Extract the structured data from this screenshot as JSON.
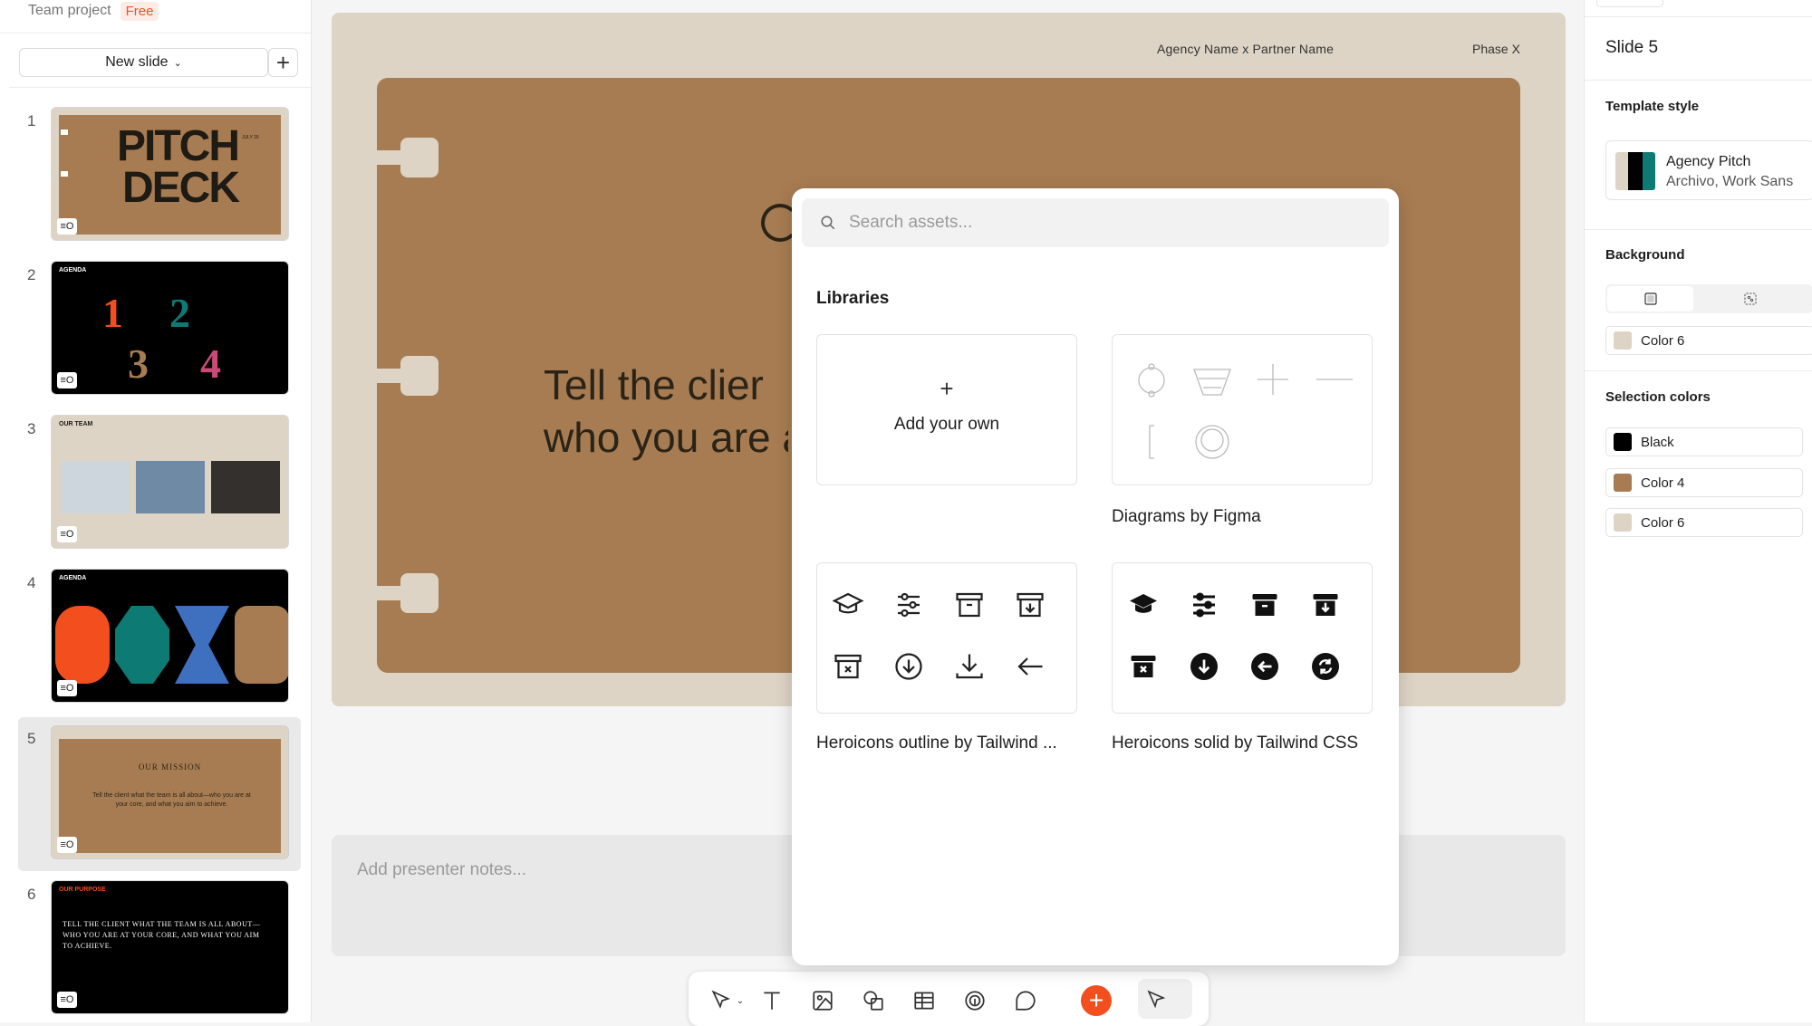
{
  "sidebar": {
    "project": "Team project",
    "badge": "Free",
    "new_slide": "New slide",
    "add_icon": "plus-icon",
    "slides": [
      {
        "num": "1",
        "title": "PITCH DECK",
        "sub": "JULY 26"
      },
      {
        "num": "2",
        "title": "AGENDA"
      },
      {
        "num": "3",
        "title": "OUR TEAM"
      },
      {
        "num": "4",
        "title": "AGENDA"
      },
      {
        "num": "5",
        "title": "OUR MISSION",
        "body": "Tell the client what the team is all about—who you are at your core, and what you aim to achieve."
      },
      {
        "num": "6",
        "title": "OUR PURPOSE",
        "body": "TELL THE CLIENT WHAT THE TEAM IS ALL ABOUT—WHO YOU ARE AT YOUR CORE, AND WHAT YOU AIM TO ACHIEVE."
      }
    ],
    "selected_index": 4
  },
  "canvas": {
    "header_agency": "Agency Name x Partner Name",
    "header_phase": "Phase X",
    "body_text": "Tell the clier\nwho you are a",
    "notes_placeholder": "Add presenter notes..."
  },
  "assets": {
    "search_placeholder": "Search assets...",
    "section_title": "Libraries",
    "add_own": "Add your own",
    "libraries": [
      {
        "name": "Diagrams by Figma"
      },
      {
        "name": "Heroicons outline by Tailwind ..."
      },
      {
        "name": "Heroicons solid by Tailwind CSS"
      }
    ]
  },
  "right_panel": {
    "slide_title": "Slide 5",
    "template_heading": "Template style",
    "template_name": "Agency Pitch",
    "template_fonts": "Archivo, Work Sans",
    "background_heading": "Background",
    "background_color": "Color 6",
    "selection_heading": "Selection colors",
    "selection_colors": [
      {
        "name": "Black",
        "hex": "#000000"
      },
      {
        "name": "Color 4",
        "hex": "#a87c52"
      },
      {
        "name": "Color 6",
        "hex": "#ddd4c6"
      }
    ]
  },
  "colors": {
    "accent": "#f24e1e",
    "slide_bg": "#ddd4c6",
    "slide_brown": "#a87c52"
  }
}
